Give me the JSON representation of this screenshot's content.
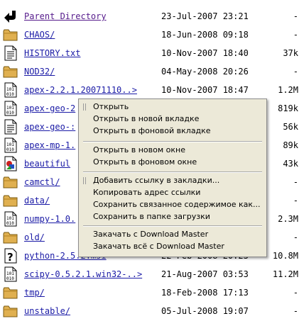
{
  "files": [
    {
      "name": "Parent Directory",
      "date": "23-Jul-2007 23:21",
      "size": "-",
      "icon": "back-arrow-icon"
    },
    {
      "name": "CHAOS/",
      "date": "18-Jun-2008 09:18",
      "size": "-",
      "icon": "folder-icon"
    },
    {
      "name": "HISTORY.txt",
      "date": "10-Nov-2007 18:40",
      "size": "37k",
      "icon": "text-file-icon"
    },
    {
      "name": "NOD32/",
      "date": "04-May-2008 20:26",
      "size": "-",
      "icon": "folder-icon"
    },
    {
      "name": "apex-2.2.1.20071110..>",
      "date": "10-Nov-2007 18:47",
      "size": "1.2M",
      "icon": "binary-file-icon"
    },
    {
      "name": "apex-geo-2",
      "date": "",
      "size": "819k",
      "icon": "binary-file-icon"
    },
    {
      "name": "apex-geo-:",
      "date": "",
      "size": "56k",
      "icon": "text-file-icon"
    },
    {
      "name": "apex-mp-1.",
      "date": "",
      "size": "89k",
      "icon": "binary-file-icon"
    },
    {
      "name": "beautiful",
      "date": "",
      "size": "43k",
      "icon": "image-file-icon"
    },
    {
      "name": "camctl/",
      "date": "",
      "size": "-",
      "icon": "folder-icon"
    },
    {
      "name": "data/",
      "date": "",
      "size": "-",
      "icon": "folder-icon"
    },
    {
      "name": "numpy-1.0.",
      "date": "",
      "size": "2.3M",
      "icon": "binary-file-icon"
    },
    {
      "name": "old/",
      "date": "",
      "size": "-",
      "icon": "folder-icon"
    },
    {
      "name": "python-2.5.2.msi",
      "date": "22-Feb-2008 20:23",
      "size": "10.8M",
      "icon": "unknown-file-icon"
    },
    {
      "name": "scipy-0.5.2.1.win32-..>",
      "date": "21-Aug-2007 03:53",
      "size": "11.2M",
      "icon": "binary-file-icon"
    },
    {
      "name": "tmp/",
      "date": "18-Feb-2008 17:13",
      "size": "-",
      "icon": "folder-icon"
    },
    {
      "name": "unstable/",
      "date": "05-Jul-2008 19:07",
      "size": "-",
      "icon": "folder-icon"
    }
  ],
  "context_menu": {
    "items": [
      "Открыть",
      "Открыть в новой вкладке",
      "Открыть в фоновой вкладке",
      "Открыть в новом окне",
      "Открыть в фоновом окне",
      "Добавить ссылку в закладки...",
      "Копировать адрес ссылки",
      "Сохранить связанное содержимое как...",
      "Сохранить в папке загрузки",
      "Закачать с Download Master",
      "Закачать всё с Download Master"
    ]
  },
  "colors": {
    "link": "#1a1aa6",
    "visited": "#551a8b",
    "folder": "#e0b050",
    "menu_bg": "#ece9d8"
  }
}
